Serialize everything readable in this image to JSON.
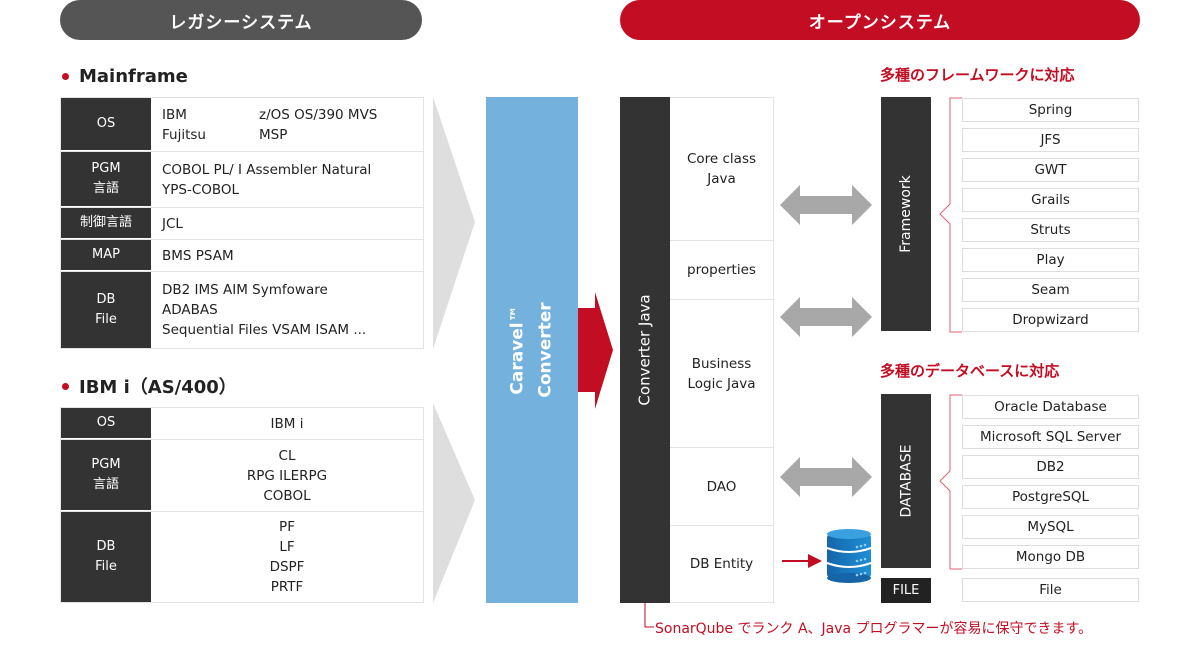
{
  "headers": {
    "legacy": "レガシーシステム",
    "open": "オープンシステム"
  },
  "mainframe": {
    "title": "Mainframe",
    "rows": [
      {
        "label": "OS",
        "lines": [
          "IBM",
          "Fujitsu"
        ],
        "lines2": [
          "z/OS OS/390 MVS",
          "MSP"
        ]
      },
      {
        "label": "PGM\n言語",
        "lines": [
          "COBOL PL/ I  Assembler Natural",
          "YPS-COBOL"
        ]
      },
      {
        "label": "制御言語",
        "lines": [
          "JCL"
        ]
      },
      {
        "label": "MAP",
        "lines": [
          "BMS PSAM"
        ]
      },
      {
        "label": "DB\nFile",
        "lines": [
          "DB2 IMS AIM Symfoware",
          "ADABAS",
          "Sequential Files VSAM ISAM ..."
        ]
      }
    ]
  },
  "ibmi": {
    "title": "IBM i（AS/400）",
    "rows": [
      {
        "label": "OS",
        "lines": [
          "IBM i"
        ]
      },
      {
        "label": "PGM\n言語",
        "lines": [
          "CL",
          "RPG ILERPG",
          "COBOL"
        ]
      },
      {
        "label": "DB\nFile",
        "lines": [
          "PF",
          "LF",
          "DSPF",
          "PRTF"
        ]
      }
    ]
  },
  "converter": {
    "label_line1": "Caravel™",
    "label_line2": "Converter"
  },
  "converter_java": {
    "label": "Converter Java",
    "cells": [
      "Core class\nJava",
      "properties",
      "Business\nLogic Java",
      "DAO",
      "DB Entity"
    ]
  },
  "framework": {
    "title": "多種のフレームワークに対応",
    "label": "Framework",
    "items": [
      "Spring",
      "JFS",
      "GWT",
      "Grails",
      "Struts",
      "Play",
      "Seam",
      "Dropwizard"
    ]
  },
  "database": {
    "title": "多種のデータベースに対応",
    "label": "DATABASE",
    "items": [
      "Oracle Database",
      "Microsoft SQL Server",
      "DB2",
      "PostgreSQL",
      "MySQL",
      "Mongo DB"
    ]
  },
  "file": {
    "label": "FILE",
    "item": "File"
  },
  "footer": "SonarQube でランク A、Java プログラマーが容易に保守できます。",
  "colors": {
    "accent": "#c30d23",
    "legacy": "#555555",
    "converter": "#74b1dc",
    "dark": "#333333"
  }
}
